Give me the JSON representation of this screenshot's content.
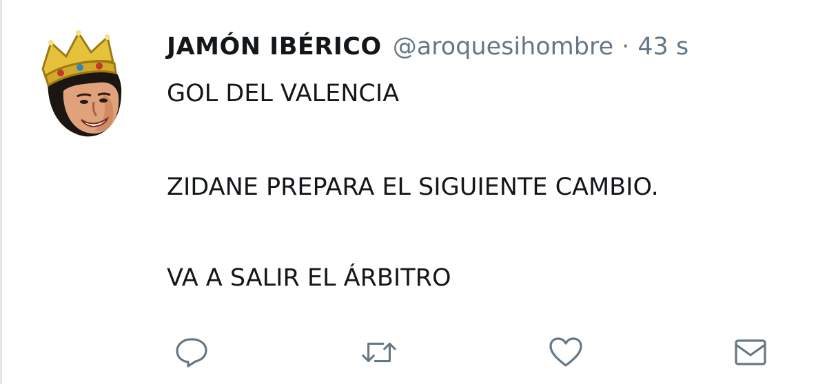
{
  "tweet": {
    "author": {
      "display_name": "JAMÓN IBÉRICO",
      "handle": "@aroquesihombre",
      "avatar": "crowned-face-avatar"
    },
    "separator": "·",
    "timestamp": "43 s",
    "text_lines": [
      "GOL DEL VALENCIA",
      "ZIDANE PREPARA EL SIGUIENTE CAMBIO.",
      "VA A SALIR EL ÁRBITRO"
    ],
    "actions": [
      {
        "name": "reply",
        "icon": "reply-bubble-icon"
      },
      {
        "name": "retweet",
        "icon": "retweet-arrows-icon"
      },
      {
        "name": "like",
        "icon": "heart-icon"
      },
      {
        "name": "direct-message",
        "icon": "envelope-icon"
      }
    ]
  },
  "colors": {
    "text": "#14171a",
    "secondary": "#657786",
    "icon": "#657786",
    "divider": "#e1e8ed"
  }
}
